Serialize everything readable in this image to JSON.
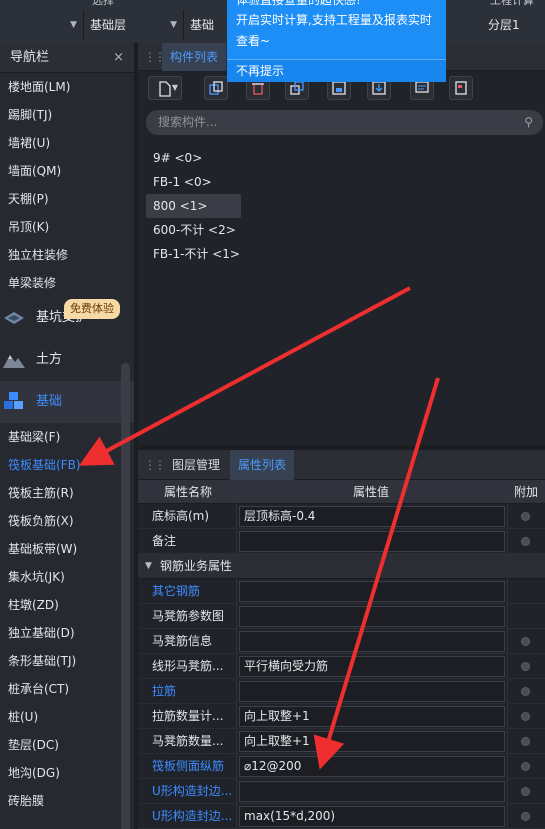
{
  "topbar": {
    "partial_labels": [
      "选择",
      "工程计算"
    ],
    "cells": [
      {
        "label": ""
      },
      {
        "label": "基础层"
      },
      {
        "label": "基础"
      },
      {
        "label": "分层1"
      }
    ]
  },
  "tooltip": {
    "line0": "体验直接查量的超快感!",
    "line1": "开启实时计算,支持工程量及报表实时",
    "line2": "查看~",
    "dismiss": "不再提示"
  },
  "nav": {
    "title": "导航栏",
    "close": "×",
    "items_top": [
      "楼地面(LM)",
      "踢脚(TJ)",
      "墙裙(U)",
      "墙面(QM)",
      "天棚(P)",
      "吊顶(K)",
      "独立柱装修",
      "单梁装修"
    ],
    "categories": [
      {
        "label": "基坑支护",
        "icon": "foundation-pit-icon"
      },
      {
        "label": "土方",
        "icon": "earthwork-icon"
      },
      {
        "label": "基础",
        "icon": "foundation-cubes-icon"
      }
    ],
    "badge": "免费体验",
    "items_bottom": [
      "基础梁(F)",
      "筏板基础(FB)",
      "筏板主筋(R)",
      "筏板负筋(X)",
      "基础板带(W)",
      "集水坑(JK)",
      "柱墩(ZD)",
      "独立基础(D)",
      "条形基础(TJ)",
      "桩承台(CT)",
      "桩(U)",
      "垫层(DC)",
      "地沟(DG)",
      "砖胎膜"
    ],
    "active_item": "筏板基础(FB)"
  },
  "components": {
    "tab": "构件列表",
    "search_placeholder": "搜索构件...",
    "items": [
      "9# <0>",
      "FB-1 <0>",
      "800 <1>",
      "600-不计 <2>",
      "FB-1-不计 <1>"
    ],
    "selected": "800 <1>"
  },
  "properties": {
    "tabs": [
      "图层管理",
      "属性列表"
    ],
    "active_tab": "属性列表",
    "headers": {
      "name": "属性名称",
      "value": "属性值",
      "extra": "附加"
    },
    "rows_top": [
      {
        "name": "底标高(m)",
        "value": "层顶标高-0.4",
        "blue": false,
        "dot": true
      },
      {
        "name": "备注",
        "value": "",
        "blue": false,
        "dot": true
      }
    ],
    "group": "钢筋业务属性",
    "rows": [
      {
        "name": "其它钢筋",
        "value": "",
        "blue": true,
        "dot": false
      },
      {
        "name": "马凳筋参数图",
        "value": "",
        "blue": false,
        "dot": false
      },
      {
        "name": "马凳筋信息",
        "value": "",
        "blue": false,
        "dot": true
      },
      {
        "name": "线形马凳筋...",
        "value": "平行横向受力筋",
        "blue": false,
        "dot": true
      },
      {
        "name": "拉筋",
        "value": "",
        "blue": true,
        "dot": true
      },
      {
        "name": "拉筋数量计...",
        "value": "向上取整+1",
        "blue": false,
        "dot": true
      },
      {
        "name": "马凳筋数量...",
        "value": "向上取整+1",
        "blue": false,
        "dot": true
      },
      {
        "name": "筏板侧面纵筋",
        "value": "⌀12@200",
        "blue": true,
        "dot": true
      },
      {
        "name": "U形构造封边...",
        "value": "",
        "blue": true,
        "dot": true
      },
      {
        "name": "U形构造封边...",
        "value": "max(15*d,200)",
        "blue": true,
        "dot": true
      }
    ]
  },
  "colors": {
    "accent": "#3d8cff",
    "tooltip": "#1e8ef7",
    "arrow": "#ef2f2f"
  }
}
